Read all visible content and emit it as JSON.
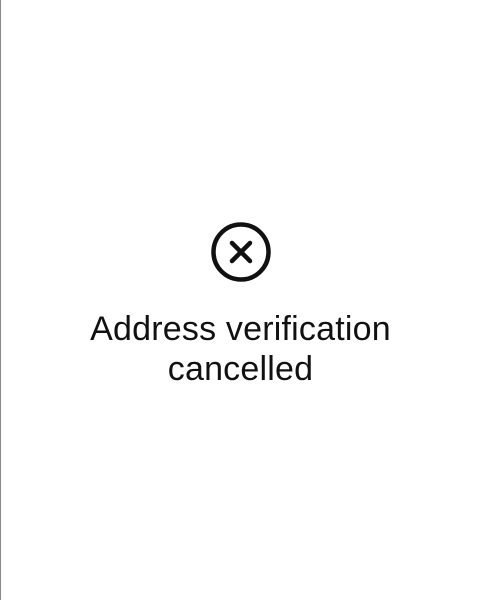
{
  "status": {
    "icon": "cancel-circle-icon",
    "message": "Address verification cancelled"
  },
  "colors": {
    "background": "#ffffff",
    "foreground": "#111111",
    "left_border": "#8c8c8c"
  }
}
